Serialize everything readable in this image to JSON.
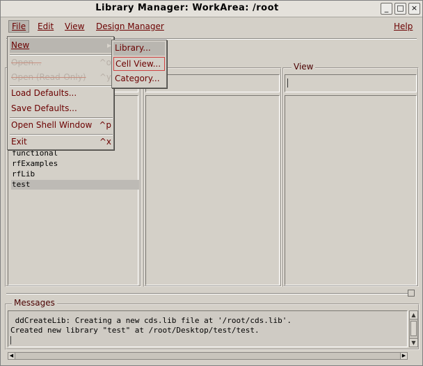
{
  "window": {
    "title": "Library Manager: WorkArea: /root",
    "buttons": {
      "minimize": "_",
      "maximize": "□",
      "close": "×"
    }
  },
  "menubar": {
    "file": "File",
    "edit": "Edit",
    "view": "View",
    "design_manager": "Design Manager",
    "help": "Help"
  },
  "columns": {
    "library": {
      "items": [
        "functional",
        "rfExamples",
        "rfLib",
        "test"
      ],
      "selected": "test"
    },
    "view": {
      "label": "View",
      "field_value": ""
    }
  },
  "file_menu": {
    "items": [
      {
        "label": "New",
        "accel": "▸",
        "state": "highlighted"
      },
      {
        "label": "Open...",
        "accel": "^o",
        "state": "disabled"
      },
      {
        "label": "Open (Read-Only)",
        "accel": "^y",
        "state": "disabled"
      },
      {
        "label": "Load Defaults...",
        "accel": "",
        "state": "normal"
      },
      {
        "label": "Save Defaults...",
        "accel": "",
        "state": "normal"
      },
      {
        "label": "Open Shell Window",
        "accel": "^p",
        "state": "normal"
      },
      {
        "label": "Exit",
        "accel": "^x",
        "state": "normal"
      }
    ]
  },
  "new_submenu": {
    "items": [
      {
        "label": "Library...",
        "state": "highlighted"
      },
      {
        "label": "Cell View...",
        "state": "boxed"
      },
      {
        "label": "Category...",
        "state": "normal"
      }
    ]
  },
  "messages": {
    "label": "Messages",
    "lines": [
      " ddCreateLib: Creating a new cds.lib file at '/root/cds.lib'.",
      "Created new library \"test\" at /root/Desktop/test/test."
    ]
  },
  "colors": {
    "accent": "#6b0000",
    "background": "#d4d0c8",
    "selection": "#bdbab5",
    "focus_box": "#d04040"
  }
}
